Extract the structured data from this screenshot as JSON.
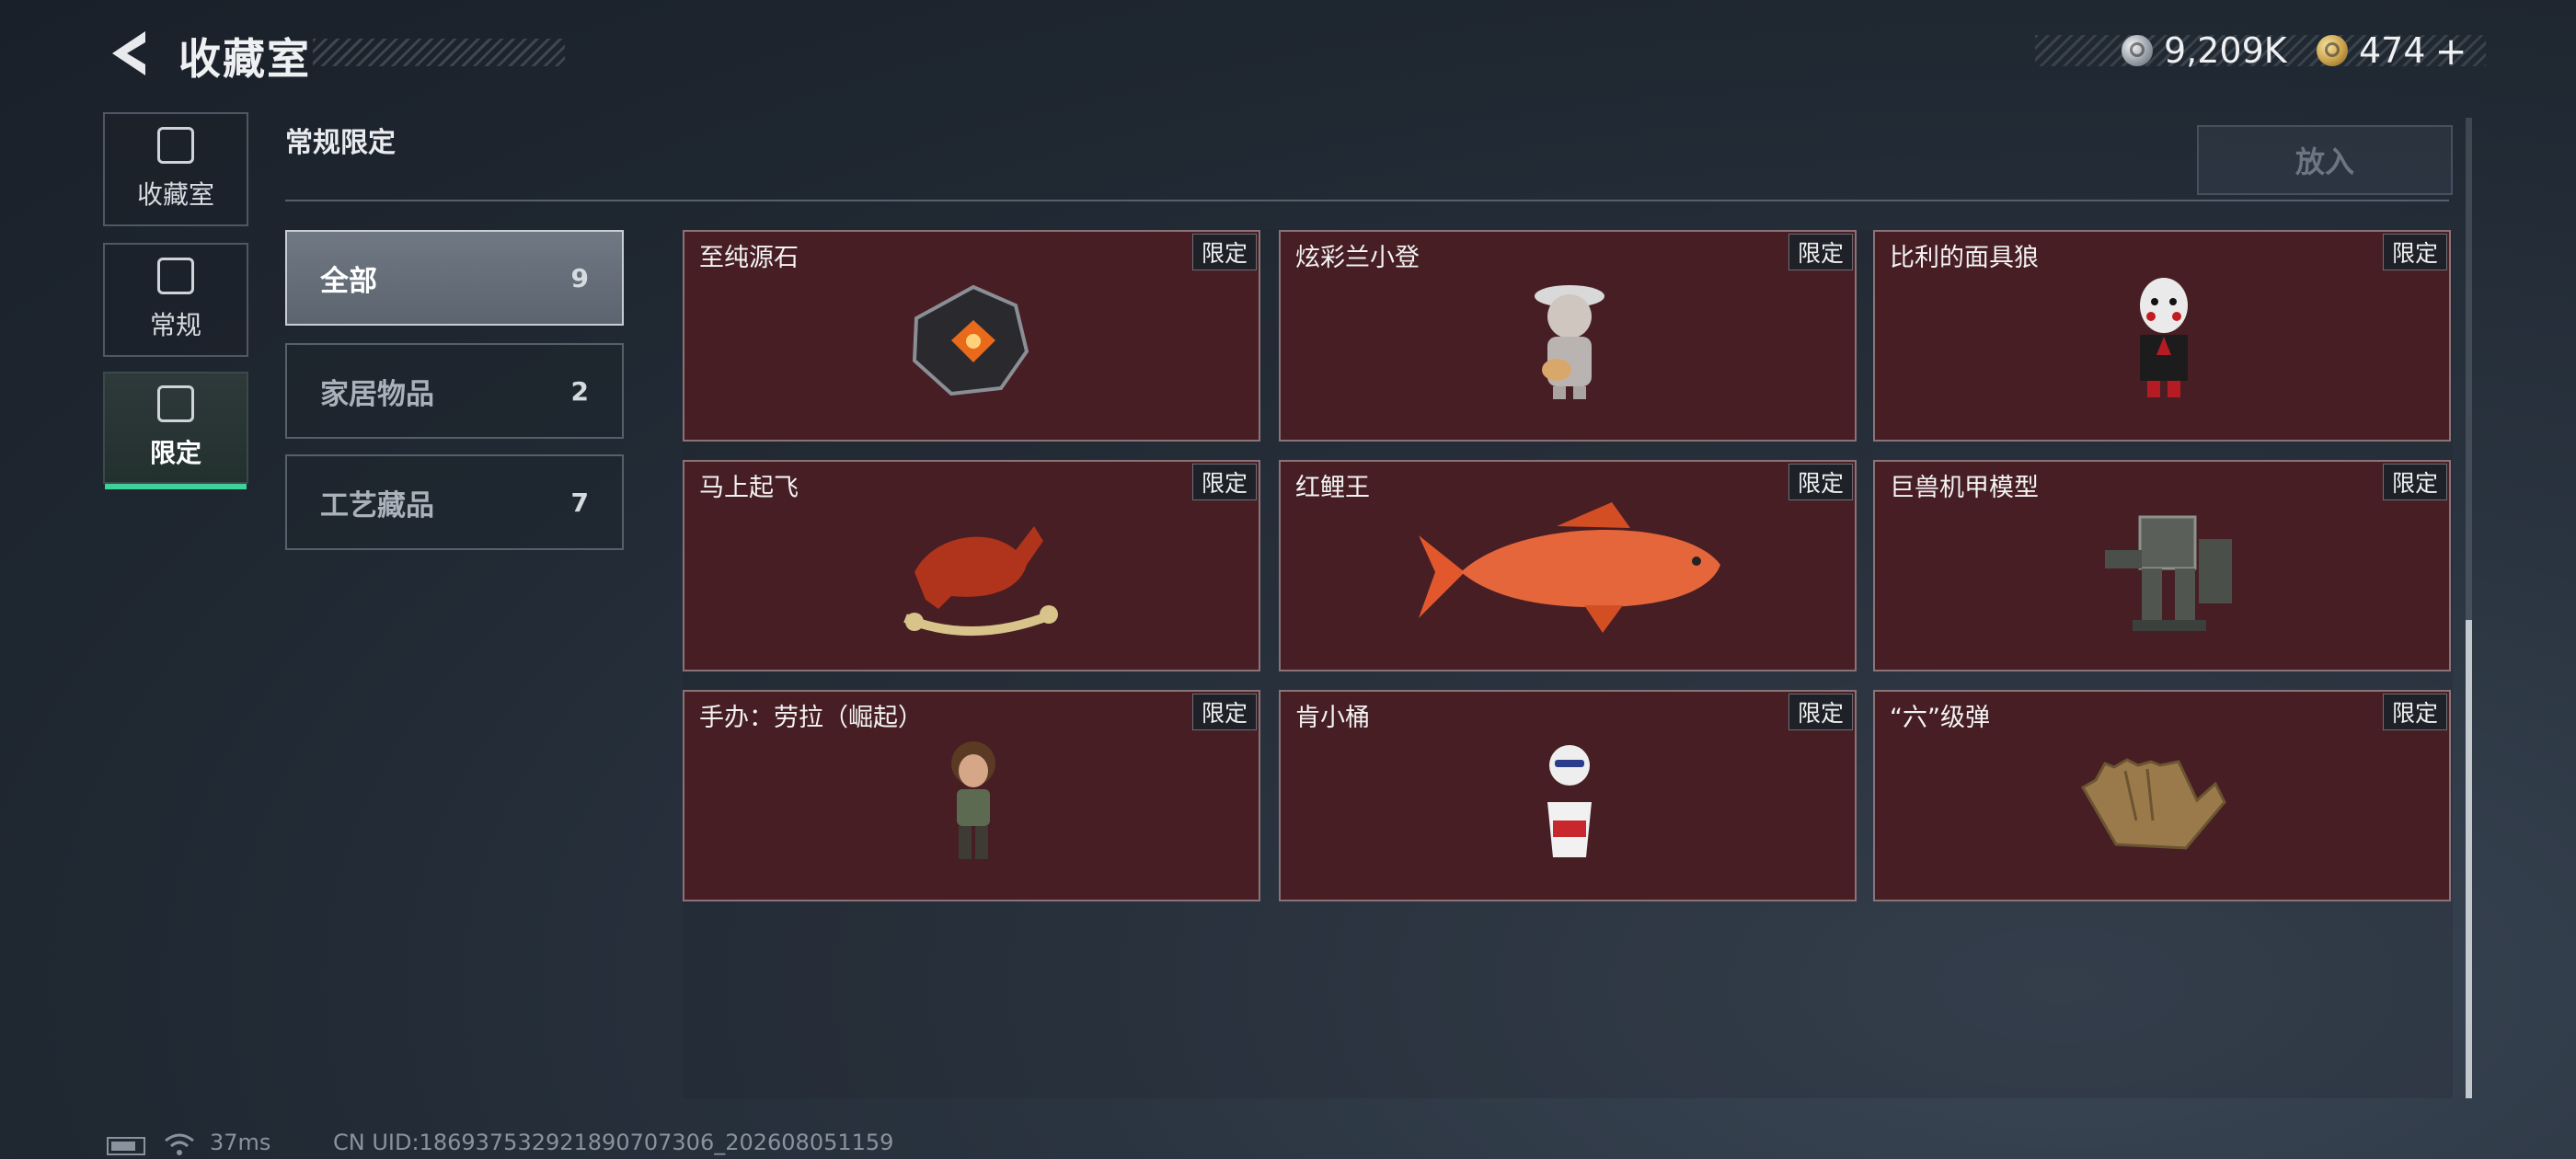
{
  "header": {
    "back_icon": "back-arrow-icon",
    "title": "收藏室",
    "currency": [
      {
        "icon": "silver-coin-icon",
        "value": "9,209K"
      },
      {
        "icon": "gold-coin-icon",
        "value": "474"
      }
    ],
    "plus": "+"
  },
  "nav": [
    {
      "label": "收藏室",
      "icon": "collection-room-icon",
      "active": false
    },
    {
      "label": "常规",
      "icon": "regular-icon",
      "active": false
    },
    {
      "label": "限定",
      "icon": "limited-icon",
      "active": true
    }
  ],
  "section": {
    "title": "常规限定",
    "put_button": "放入"
  },
  "filters": [
    {
      "label": "全部",
      "count": "9",
      "active": true
    },
    {
      "label": "家居物品",
      "count": "2",
      "active": false
    },
    {
      "label": "工艺藏品",
      "count": "7",
      "active": false
    }
  ],
  "items": [
    {
      "name": "至纯源石",
      "tag": "限定",
      "icon": "crystal-stone-icon"
    },
    {
      "name": "炫彩兰小登",
      "tag": "限定",
      "icon": "figure-guitar-icon"
    },
    {
      "name": "比利的面具狼",
      "tag": "限定",
      "icon": "puppet-figure-icon"
    },
    {
      "name": "马上起飞",
      "tag": "限定",
      "icon": "rocking-horse-icon"
    },
    {
      "name": "红鲤王",
      "tag": "限定",
      "icon": "red-carp-icon"
    },
    {
      "name": "巨兽机甲模型",
      "tag": "限定",
      "icon": "mech-model-icon"
    },
    {
      "name": "手办：劳拉（崛起）",
      "tag": "限定",
      "icon": "lara-figure-icon"
    },
    {
      "name": "肯小桶",
      "tag": "限定",
      "icon": "bucket-figure-icon"
    },
    {
      "name": "“六”级弹",
      "tag": "限定",
      "icon": "hand-sculpture-icon"
    }
  ],
  "footer": {
    "ping": "37ms",
    "uid": "CN UID:1869375329218907073​06_202608051159"
  },
  "colors": {
    "accent_green": "#3fd19b",
    "card_bg": "#461e24"
  }
}
